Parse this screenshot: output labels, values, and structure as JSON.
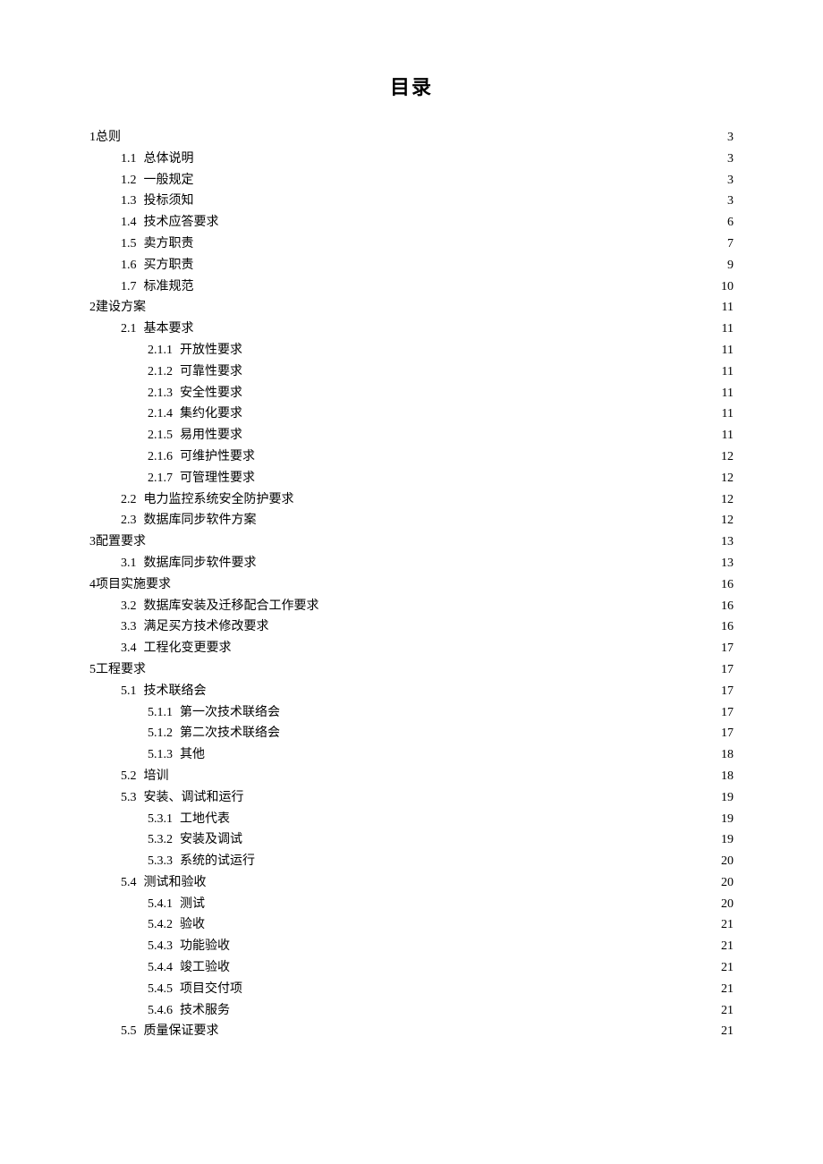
{
  "title": "目录",
  "entries": [
    {
      "level": 0,
      "num": "1总则",
      "label": "",
      "page": "3",
      "tight": true
    },
    {
      "level": 1,
      "num": "1.1",
      "label": "总体说明",
      "page": "3"
    },
    {
      "level": 1,
      "num": "1.2",
      "label": "一般规定",
      "page": "3"
    },
    {
      "level": 1,
      "num": "1.3",
      "label": "投标须知",
      "page": "3",
      "tight": true
    },
    {
      "level": 1,
      "num": "1.4",
      "label": "技术应答要求",
      "page": "6",
      "tight": true
    },
    {
      "level": 1,
      "num": "1.5",
      "label": "卖方职责",
      "page": "7",
      "tight": true
    },
    {
      "level": 1,
      "num": "1.6",
      "label": "买方职责",
      "page": "9",
      "tight": true
    },
    {
      "level": 1,
      "num": "1.7",
      "label": "标准规范",
      "page": "10",
      "tight": true
    },
    {
      "level": 0,
      "num": "2建设方案",
      "label": "",
      "page": "11",
      "tight": true
    },
    {
      "level": 1,
      "num": "2.1",
      "label": "基本要求",
      "page": "11",
      "tight": true
    },
    {
      "level": 2,
      "num": "2.1.1",
      "label": "开放性要求",
      "page": "11"
    },
    {
      "level": 2,
      "num": "2.1.2",
      "label": "可靠性要求",
      "page": "11"
    },
    {
      "level": 2,
      "num": "2.1.3",
      "label": "安全性要求",
      "page": "11"
    },
    {
      "level": 2,
      "num": "2.1.4",
      "label": "集约化要求",
      "page": "11"
    },
    {
      "level": 2,
      "num": "2.1.5",
      "label": "易用性要求",
      "page": "11"
    },
    {
      "level": 2,
      "num": "2.1.6",
      "label": "可维护性要求",
      "page": "12"
    },
    {
      "level": 2,
      "num": "2.1.7",
      "label": "可管理性要求",
      "page": "12"
    },
    {
      "level": 1,
      "num": "2.2",
      "label": "电力监控系统安全防护要求",
      "page": "12",
      "tight": true
    },
    {
      "level": 1,
      "num": "2.3",
      "label": "数据库同步软件方案",
      "page": "12",
      "tight": true
    },
    {
      "level": 0,
      "num": "3配置要求",
      "label": "",
      "page": "13",
      "tight": true
    },
    {
      "level": 1,
      "num": "3.1",
      "label": "数据库同步软件要求",
      "page": "13",
      "tight": true
    },
    {
      "level": 0,
      "num": "4项目实施要求",
      "label": "",
      "page": "16",
      "tight": true
    },
    {
      "level": 1,
      "num": "3.2",
      "label": "数据库安装及迁移配合工作要求",
      "page": "16",
      "tight": true
    },
    {
      "level": 1,
      "num": "3.3",
      "label": "满足买方技术修改要求",
      "page": "16",
      "tight": true
    },
    {
      "level": 1,
      "num": "3.4",
      "label": "工程化变更要求",
      "page": "17",
      "tight": true
    },
    {
      "level": 0,
      "num": "5工程要求",
      "label": "",
      "page": "17",
      "tight": true
    },
    {
      "level": 1,
      "num": "5.1",
      "label": "技术联络会",
      "page": "17",
      "tight": true
    },
    {
      "level": 2,
      "num": "5.1.1",
      "label": "第一次技术联络会",
      "page": "17"
    },
    {
      "level": 2,
      "num": "5.1.2",
      "label": "第二次技术联络会",
      "page": "17"
    },
    {
      "level": 2,
      "num": "5.1.3",
      "label": "其他",
      "page": "18"
    },
    {
      "level": 1,
      "num": "5.2",
      "label": "培训",
      "page": "18",
      "tight": true
    },
    {
      "level": 1,
      "num": "5.3",
      "label": "安装、调试和运行",
      "page": "19",
      "tight": true
    },
    {
      "level": 2,
      "num": "5.3.1",
      "label": "工地代表",
      "page": "19"
    },
    {
      "level": 2,
      "num": "5.3.2",
      "label": "安装及调试",
      "page": "19"
    },
    {
      "level": 2,
      "num": "5.3.3",
      "label": "系统的试运行",
      "page": "20"
    },
    {
      "level": 1,
      "num": "5.4",
      "label": "测试和验收",
      "page": "20",
      "tight": true
    },
    {
      "level": 2,
      "num": "5.4.1",
      "label": "测试",
      "page": "20"
    },
    {
      "level": 2,
      "num": "5.4.2",
      "label": "验收",
      "page": "21"
    },
    {
      "level": 2,
      "num": "5.4.3",
      "label": "功能验收",
      "page": "21"
    },
    {
      "level": 2,
      "num": "5.4.4",
      "label": "竣工验收",
      "page": "21"
    },
    {
      "level": 2,
      "num": "5.4.5",
      "label": "项目交付项",
      "page": "21"
    },
    {
      "level": 2,
      "num": "5.4.6",
      "label": "技术服务",
      "page": "21"
    },
    {
      "level": 1,
      "num": "5.5",
      "label": "质量保证要求",
      "page": "21"
    }
  ]
}
